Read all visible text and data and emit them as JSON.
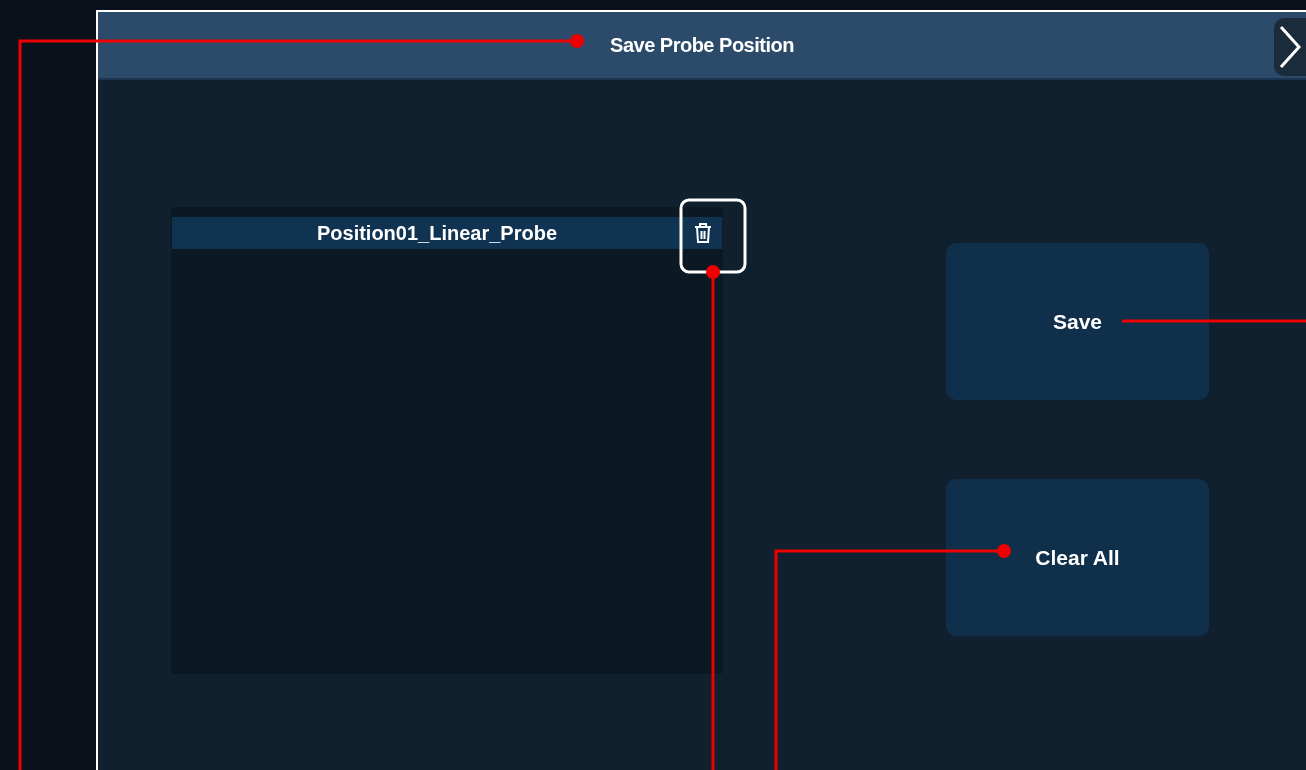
{
  "dialog": {
    "title": "Save Probe Position"
  },
  "positions": [
    {
      "label": "Position01_Linear_Probe"
    }
  ],
  "buttons": [
    {
      "label": "Save"
    },
    {
      "label": "Clear All"
    }
  ]
}
